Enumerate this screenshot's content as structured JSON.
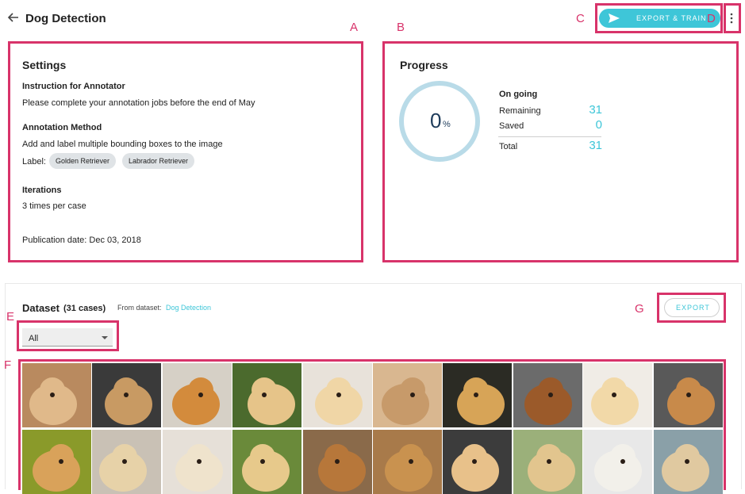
{
  "header": {
    "title": "Dog Detection"
  },
  "annotations": {
    "a": "A",
    "b": "B",
    "c": "C",
    "d": "D",
    "e": "E",
    "f": "F",
    "g": "G"
  },
  "top_actions": {
    "export_train_label": "EXPORT & TRAIN",
    "icons": [
      "send-icon",
      "kebab-icon",
      "back-arrow-icon"
    ]
  },
  "settings": {
    "title": "Settings",
    "instruction_heading": "Instruction for Annotator",
    "instruction_text": "Please complete your annotation jobs before the end of May",
    "method_heading": "Annotation Method",
    "method_text": "Add and label multiple bounding boxes to the image",
    "label_prefix": "Label:",
    "labels": [
      "Golden Retriever",
      "Labrador Retriever"
    ],
    "iterations_heading": "Iterations",
    "iterations_text": "3 times per case",
    "publication": "Publication date: Dec 03, 2018"
  },
  "progress": {
    "title": "Progress",
    "percent": "0",
    "percent_symbol": "%",
    "status": "On going",
    "remaining_label": "Remaining",
    "remaining_value": "31",
    "saved_label": "Saved",
    "saved_value": "0",
    "total_label": "Total",
    "total_value": "31",
    "ring_color": "#b9dbe8",
    "number_color": "#3ec6d8"
  },
  "dataset": {
    "title": "Dataset",
    "count": "(31 cases)",
    "from_label": "From dataset:",
    "from_link": "Dog Detection",
    "export_label": "EXPORT",
    "filter_value": "All",
    "images": [
      {
        "alt": "dog photo 1",
        "bg": "#b98a5f",
        "fg": "#e0b98a"
      },
      {
        "alt": "dog photo 2",
        "bg": "#3a3a3a",
        "fg": "#c89a63"
      },
      {
        "alt": "dog photo 3",
        "bg": "#d6d0c6",
        "fg": "#d38b3c"
      },
      {
        "alt": "dog photo 4",
        "bg": "#4b6a2d",
        "fg": "#e6c489"
      },
      {
        "alt": "dog photo 5",
        "bg": "#e8e2da",
        "fg": "#f0d6a6"
      },
      {
        "alt": "dog photo 6",
        "bg": "#d9b790",
        "fg": "#c79a6a"
      },
      {
        "alt": "dog photo 7",
        "bg": "#2b2b24",
        "fg": "#d7a457"
      },
      {
        "alt": "dog photo 8",
        "bg": "#6b6b6b",
        "fg": "#9b5a2a"
      },
      {
        "alt": "dog photo 9",
        "bg": "#f0ece6",
        "fg": "#f2d9a8"
      },
      {
        "alt": "dog photo 10",
        "bg": "#595959",
        "fg": "#c88a4a"
      },
      {
        "alt": "dog photo 11",
        "bg": "#8a9a2a",
        "fg": "#d9a25a"
      },
      {
        "alt": "dog photo 12",
        "bg": "#c9c1b5",
        "fg": "#e7d2a8"
      },
      {
        "alt": "dog photo 13",
        "bg": "#e6e0d8",
        "fg": "#efe3cc"
      },
      {
        "alt": "dog photo 14",
        "bg": "#6a8a3a",
        "fg": "#e7c98b"
      },
      {
        "alt": "dog photo 15",
        "bg": "#8a6a4a",
        "fg": "#b7773a"
      },
      {
        "alt": "dog photo 16",
        "bg": "#a87a4a",
        "fg": "#c9924f"
      },
      {
        "alt": "dog photo 17",
        "bg": "#3c3c3c",
        "fg": "#e8c18a"
      },
      {
        "alt": "dog photo 18",
        "bg": "#9bb07a",
        "fg": "#e2c58e"
      },
      {
        "alt": "dog photo 19",
        "bg": "#e8e8e8",
        "fg": "#f2f0ea"
      },
      {
        "alt": "dog photo 20",
        "bg": "#8aa0a8",
        "fg": "#e0c9a0"
      }
    ]
  }
}
